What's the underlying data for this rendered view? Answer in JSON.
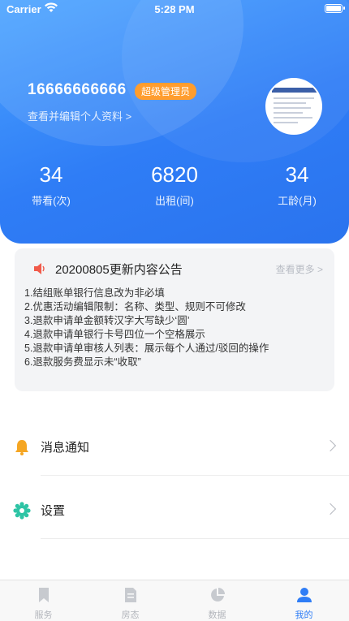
{
  "status_bar": {
    "carrier": "Carrier",
    "time": "5:28 PM"
  },
  "profile": {
    "phone": "16666666666",
    "role": "超级管理员",
    "edit_link": "查看并编辑个人资料 >"
  },
  "stats": [
    {
      "value": "34",
      "label": "带看(次)"
    },
    {
      "value": "6820",
      "label": "出租(间)"
    },
    {
      "value": "34",
      "label": "工龄(月)"
    }
  ],
  "notice": {
    "icon": "speaker-icon",
    "title": "20200805更新内容公告",
    "more": "查看更多 >",
    "lines": [
      "1.结组账单银行信息改为非必填",
      "2.优惠活动编辑限制：名称、类型、规则不可修改",
      "3.退款申请单金额转汉字大写缺少‘圆’",
      "4.退款申请单银行卡号四位一个空格展示",
      "5.退款申请单审核人列表：展示每个人通过/驳回的操作",
      "6.退款服务费显示未“收取”"
    ]
  },
  "menu": [
    {
      "icon": "bell-icon",
      "label": "消息通知"
    },
    {
      "icon": "gear-icon",
      "label": "设置"
    }
  ],
  "tabs": [
    {
      "icon": "bookmark-icon",
      "label": "服务"
    },
    {
      "icon": "document-icon",
      "label": "房态"
    },
    {
      "icon": "pie-chart-icon",
      "label": "数据"
    },
    {
      "icon": "user-icon",
      "label": "我的"
    }
  ],
  "colors": {
    "primary": "#2f7df6",
    "badge": "#ff9d2e",
    "bell": "#f5a623",
    "gear": "#2ec4a5",
    "speaker": "#f15a4a"
  }
}
